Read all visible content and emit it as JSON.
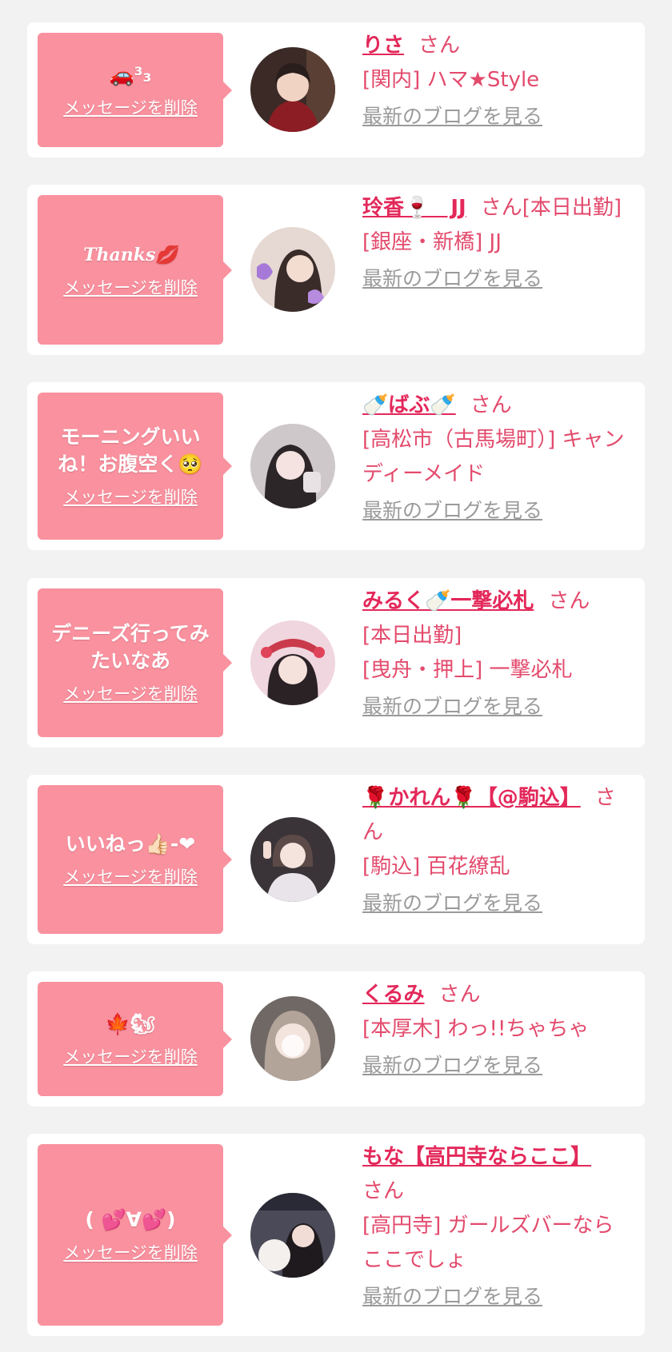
{
  "delete_label": "メッセージを削除",
  "blog_label": "最新のブログを見る",
  "san_label": "さん",
  "colors": {
    "background": "#f2f2f2",
    "bubble": "#f9919f",
    "name": "#e3285a",
    "text": "#e34a6c",
    "blog": "#9a9a9a"
  },
  "messages": [
    {
      "message": "🚗³₃",
      "name": "りさ",
      "suffix": "さん",
      "store": "[関内] ハマ★Style",
      "avatar_color": "#7a1e24"
    },
    {
      "message": "Thanks💋",
      "name": "玲香🍷　JJ",
      "suffix": "さん[本日出勤]",
      "store": "[銀座・新橋] JJ",
      "avatar_color": "#d9c6c0"
    },
    {
      "message": "モーニングいいね！お腹空く🥺",
      "name": "🍼ばぶ🍼",
      "suffix": "さん",
      "store": "[高松市（古馬場町）] キャンディーメイド",
      "avatar_color": "#3a3236"
    },
    {
      "message": "デニーズ行ってみたいなあ",
      "name": "みるく🍼一撃必札",
      "suffix": "さん",
      "extra": "[本日出勤]",
      "store": "[曳舟・押上] 一撃必札",
      "avatar_color": "#e7b9c6"
    },
    {
      "message": "いいねっ👍🏻-❤",
      "name": "🌹かれん🌹【@駒込】",
      "suffix": "さん",
      "store": "[駒込] 百花繚乱",
      "avatar_color": "#4a4448"
    },
    {
      "message": "🍁🐿",
      "name": "くるみ",
      "suffix": "さん",
      "store": "[本厚木] わっ!!ちゃちゃ",
      "avatar_color": "#8a7f7c"
    },
    {
      "message": "( 💕∀💕)",
      "name": "もな【高円寺ならここ】",
      "suffix": "さん",
      "store": "[高円寺] ガールズバーならここでしょ",
      "avatar_color": "#5c5560"
    }
  ]
}
